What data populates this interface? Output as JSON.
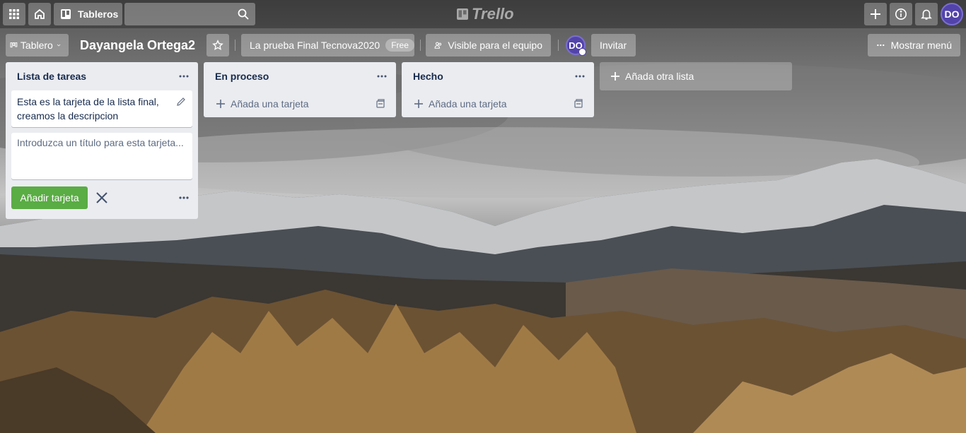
{
  "header": {
    "boards_label": "Tableros",
    "search_placeholder": "",
    "logo_text": "Trello",
    "user_initials": "DO"
  },
  "board_bar": {
    "view_label": "Tablero",
    "title": "Dayangela Ortega2",
    "team_name": "La prueba Final Tecnova2020",
    "team_badge": "Free",
    "visibility_label": "Visible para el equipo",
    "member_initials": "DO",
    "invite_label": "Invitar",
    "menu_label": "Mostrar menú"
  },
  "lists": [
    {
      "title": "Lista de tareas",
      "cards": [
        "Esta es la tarjeta de la lista final, creamos la descripcion"
      ],
      "composer_placeholder": "Introduzca un título para esta tarjeta...",
      "add_button_label": "Añadir tarjeta"
    },
    {
      "title": "En proceso",
      "add_card_label": "Añada una tarjeta"
    },
    {
      "title": "Hecho",
      "add_card_label": "Añada una tarjeta"
    }
  ],
  "add_list_label": "Añada otra lista",
  "colors": {
    "accent_green": "#5aac44",
    "avatar_purple": "#5243aa",
    "list_bg": "#ebecf0"
  }
}
